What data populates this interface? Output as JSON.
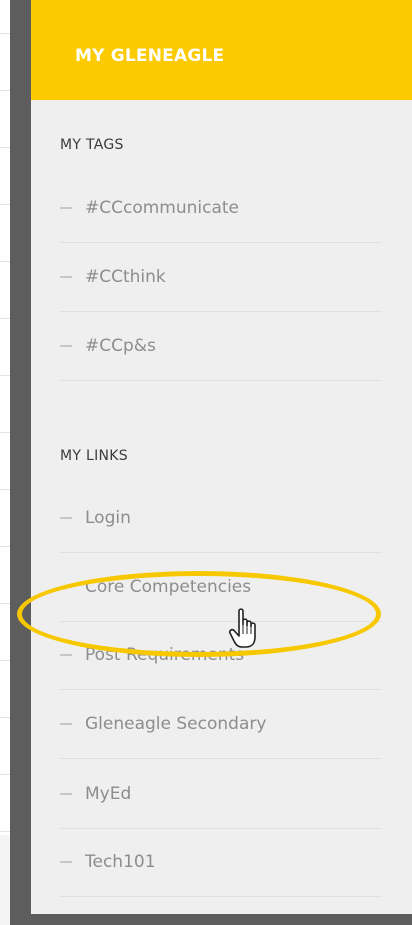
{
  "header": {
    "title": "MY GLENEAGLE"
  },
  "tags": {
    "title": "MY TAGS",
    "items": [
      {
        "label": "#CCcommunicate"
      },
      {
        "label": "#CCthink"
      },
      {
        "label": "#CCp&s"
      }
    ]
  },
  "links": {
    "title": "MY LINKS",
    "items": [
      {
        "label": "Login"
      },
      {
        "label": "Core Competencies"
      },
      {
        "label": "Post Requirements"
      },
      {
        "label": "Gleneagle Secondary"
      },
      {
        "label": "MyEd"
      },
      {
        "label": "Tech101"
      }
    ]
  },
  "colors": {
    "header": "#fcca00",
    "highlight": "#f7c800",
    "frame": "#5d5d5d"
  },
  "annotation": {
    "shape": "ellipse",
    "target": "Core Competencies"
  },
  "cursor": {
    "icon": "hand-pointer-icon"
  }
}
